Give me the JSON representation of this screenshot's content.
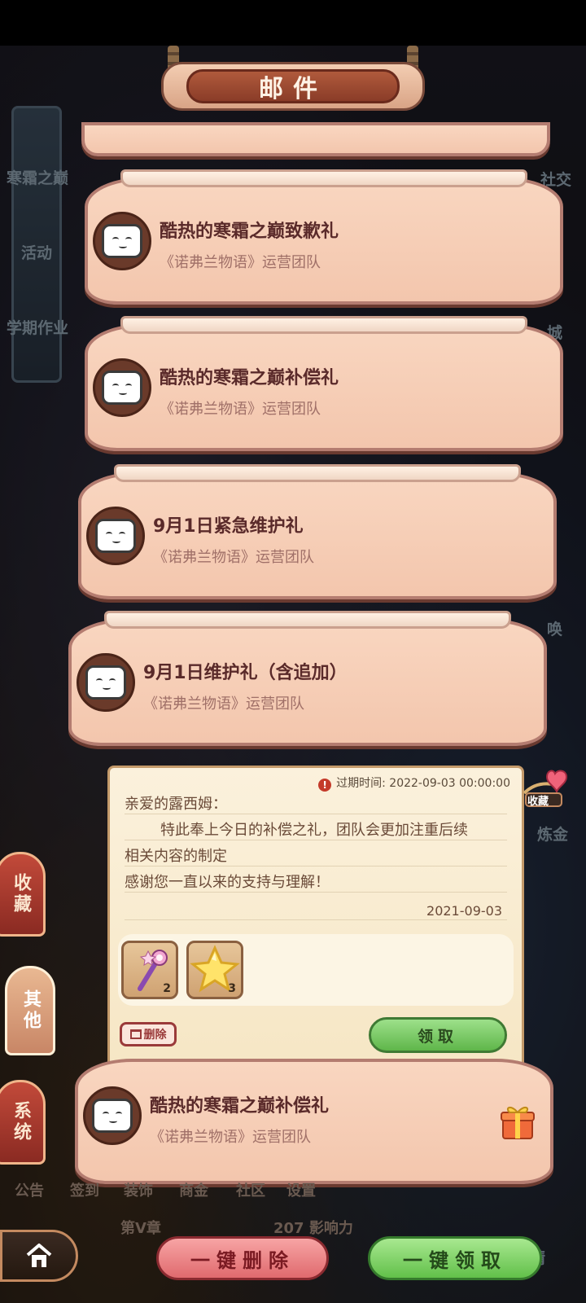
{
  "header": {
    "title": "邮件"
  },
  "side_menu": {
    "left": [
      "寒霜之巅",
      "活动",
      "学期作业"
    ],
    "right": [
      "社交",
      "城",
      "唤",
      "炼金",
      "妖精"
    ]
  },
  "mails": [
    {
      "title": "酷热的寒霜之巅致歉礼",
      "sender": "《诺弗兰物语》运营团队"
    },
    {
      "title": "酷热的寒霜之巅补偿礼",
      "sender": "《诺弗兰物语》运营团队"
    },
    {
      "title": "9月1日紧急维护礼",
      "sender": "《诺弗兰物语》运营团队"
    },
    {
      "title": "9月1日维护礼（含追加）",
      "sender": "《诺弗兰物语》运营团队"
    }
  ],
  "detail": {
    "expire_label": "过期时间: 2022-09-03 00:00:00",
    "greeting": "亲爱的露西姆：",
    "body_line1": "特此奉上今日的补偿之礼，团队会更加注重后续",
    "body_line2": "相关内容的制定",
    "body_line3": "感谢您一直以来的支持与理解！",
    "date": "2021-09-03",
    "items": [
      {
        "icon": "magic-wand-icon",
        "count": "2"
      },
      {
        "icon": "star-icon",
        "count": "3"
      }
    ],
    "delete_label": "删除",
    "claim_label": "领取"
  },
  "selected_mail": {
    "title": "酷热的寒霜之巅补偿礼",
    "sender": "《诺弗兰物语》运营团队"
  },
  "collect_tag": "收藏",
  "side_tabs": [
    "收藏",
    "其他",
    "系统"
  ],
  "bottom_labels": [
    "公告",
    "签到",
    "装饰",
    "商金",
    "社区",
    "设置"
  ],
  "bottom_info": {
    "chapter": "第V章",
    "influence": "207 影响力"
  },
  "bottom_buttons": {
    "delete_all": "一键删除",
    "claim_all": "一键领取"
  }
}
